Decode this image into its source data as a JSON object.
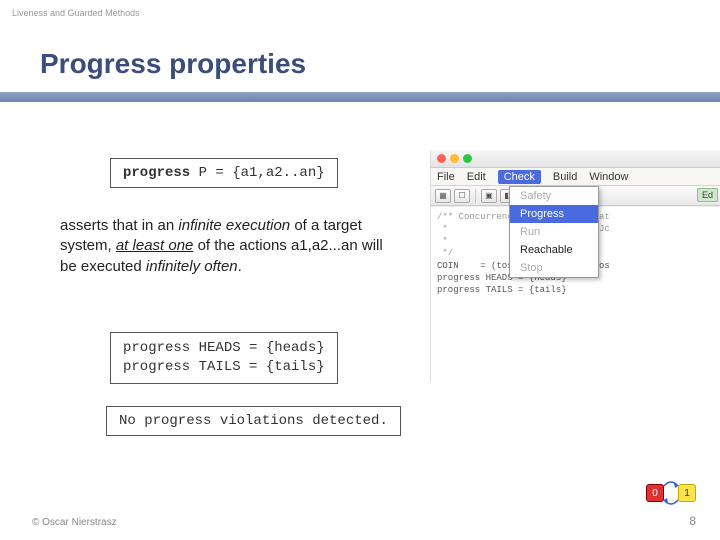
{
  "header": {
    "breadcrumb": "Liveness and Guarded Methods"
  },
  "title": "Progress properties",
  "codebox1": {
    "kw": "progress",
    "rest": " P = {a1,a2..an}"
  },
  "body": {
    "p1": "asserts that in an ",
    "ital1": "infinite execution",
    "p2": " of a target system, ",
    "ul1": "at least one",
    "p3": " of the actions a1,a2...an will be executed ",
    "ital2": "infinitely often",
    "p4": "."
  },
  "codebox2": {
    "l1": "progress HEADS = {heads}",
    "l2": "progress TAILS = {tails}"
  },
  "codebox3": {
    "l1": "No progress violations detected."
  },
  "footer": {
    "credit": "© Oscar Nierstrasz",
    "page": "8"
  },
  "shot": {
    "menubar": [
      "File",
      "Edit",
      "Check",
      "Build",
      "Window"
    ],
    "dropdown": {
      "safety": "Safety",
      "progress": "Progress",
      "run": "Run",
      "reachable": "Reachable",
      "stop": "Stop"
    },
    "toolbar_label": "Ed",
    "editor": {
      "c1": "/** Concurrency: State Models at",
      "c2": " *             Jeff Magee and Jc",
      "c3": " *",
      "c4": " */",
      "blank": "",
      "l1": "COIN    = (toss->heads->COIN|tos",
      "l2": "progress HEADS = {heads}",
      "l3": "progress TAILS = {tails}"
    }
  },
  "fsp": {
    "n0": "0",
    "n1": "1"
  }
}
